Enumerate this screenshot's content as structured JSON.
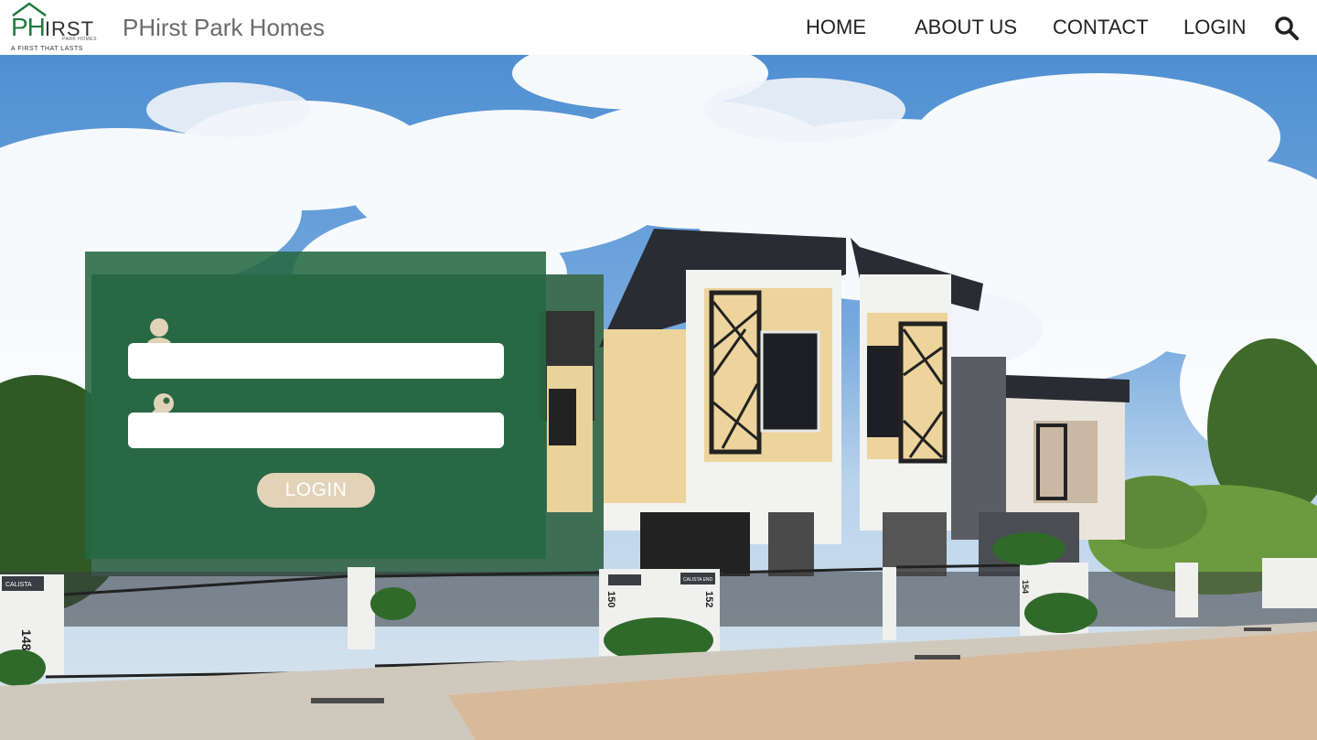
{
  "header": {
    "logo": {
      "ph": "PH",
      "irst": "IRST",
      "sub": "PARK HOMES",
      "tagline": "A FIRST THAT LASTS"
    },
    "title": "PHirst Park Homes",
    "nav": {
      "home": "HOME",
      "about": "ABOUT US",
      "contact": "CONTACT",
      "login": "LOGIN"
    },
    "search_icon": "search-icon"
  },
  "hero": {
    "unit_numbers": [
      "148",
      "150",
      "152",
      "154"
    ],
    "signs": [
      "CALISTA",
      "CALISTA END"
    ]
  },
  "login_form": {
    "username_icon": "user-icon",
    "username_value": "",
    "password_icon": "key-icon",
    "password_value": "",
    "button_label": "LOGIN"
  },
  "colors": {
    "brand_green": "#1f7a3c",
    "panel_green": "#266842",
    "button_beige": "#e2d2b7",
    "header_bg": "#ffffff"
  }
}
